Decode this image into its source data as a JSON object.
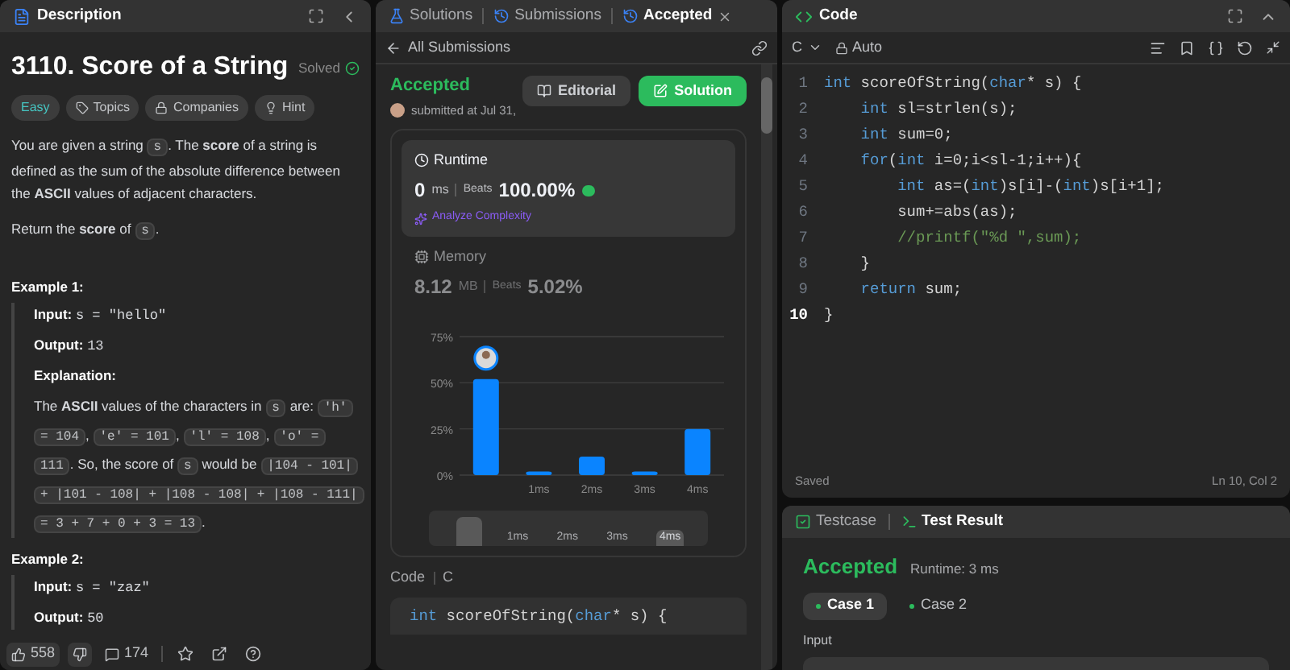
{
  "description_panel": {
    "tab": "Description",
    "title": "3110. Score of a String",
    "status": "Solved",
    "tags": [
      {
        "kind": "difficulty",
        "label": "Easy"
      },
      {
        "kind": "topics",
        "label": "Topics"
      },
      {
        "kind": "companies",
        "label": "Companies"
      },
      {
        "kind": "hint",
        "label": "Hint"
      }
    ],
    "paragraphs": [
      [
        {
          "kind": "text",
          "text": "You are given a string "
        },
        {
          "kind": "code",
          "text": "s"
        },
        {
          "kind": "text",
          "text": ". The **score** of a string is defined as the sum of the absolute difference between the **ASCII** values of adjacent characters."
        }
      ],
      [
        {
          "kind": "text",
          "text": "Return the **score** of "
        },
        {
          "kind": "code",
          "text": "s"
        },
        {
          "kind": "text",
          "text": "."
        }
      ]
    ],
    "examples": [
      {
        "title": "Example 1:",
        "input_label": "Input:",
        "input": "s = \"hello\"",
        "output_label": "Output:",
        "output": "13",
        "explanation_label": "Explanation:",
        "explanation": [
          {
            "kind": "text",
            "text": "The **ASCII** values of the characters in "
          },
          {
            "kind": "code",
            "text": "s"
          },
          {
            "kind": "text",
            "text": " are: "
          },
          {
            "kind": "code",
            "text": "'h' = 104"
          },
          {
            "kind": "text",
            "text": ", "
          },
          {
            "kind": "code",
            "text": "'e' = 101"
          },
          {
            "kind": "text",
            "text": ", "
          },
          {
            "kind": "code",
            "text": "'l' = 108"
          },
          {
            "kind": "text",
            "text": ", "
          },
          {
            "kind": "code",
            "text": "'o' = 111"
          },
          {
            "kind": "text",
            "text": ". So, the score of "
          },
          {
            "kind": "code",
            "text": "s"
          },
          {
            "kind": "text",
            "text": " would be "
          },
          {
            "kind": "code",
            "text": "|104 - 101| + |101 - 108| + |108 - 108| + |108 - 111| = 3 + 7 + 0 + 3 = 13"
          },
          {
            "kind": "text",
            "text": "."
          }
        ]
      },
      {
        "title": "Example 2:",
        "input_label": "Input:",
        "input": "s = \"zaz\"",
        "output_label": "Output:",
        "output": "50"
      }
    ],
    "footer": {
      "likes": "558",
      "comments": "174"
    }
  },
  "submission_panel": {
    "tabs": [
      {
        "kind": "solutions",
        "label": "Solutions",
        "selected": false
      },
      {
        "kind": "submissions",
        "label": "Submissions",
        "selected": false
      },
      {
        "kind": "submission",
        "label": "Accepted",
        "selected": true
      }
    ],
    "back_link": "All Submissions",
    "status": "Accepted",
    "submitted": "submitted at Jul 31,",
    "buttons": [
      {
        "kind": "editorial",
        "label": "Editorial"
      },
      {
        "kind": "solution",
        "label": "Solution"
      }
    ],
    "stats": [
      {
        "kind": "runtime",
        "label": "Runtime",
        "value": "0",
        "unit": "ms",
        "beats_label": "Beats",
        "beats": "100.00%",
        "link": "Analyze Complexity",
        "selected": true
      },
      {
        "kind": "memory",
        "label": "Memory",
        "value": "8.12",
        "unit": "MB",
        "beats_label": "Beats",
        "beats": "5.02%",
        "selected": false
      }
    ],
    "chart_data": {
      "type": "bar",
      "x": [
        0,
        1,
        2,
        3,
        4
      ],
      "xlim": [
        -0.5,
        4.5
      ],
      "values": [
        52,
        2,
        10,
        2,
        25
      ],
      "xticks": [
        {
          "value": 1,
          "label": "1ms"
        },
        {
          "value": 2,
          "label": "2ms"
        },
        {
          "value": 3,
          "label": "3ms"
        },
        {
          "value": 4,
          "label": "4ms"
        }
      ],
      "ylim": [
        0,
        75
      ],
      "grid": true,
      "yticks": [
        {
          "value": 0,
          "label": "0%"
        },
        {
          "value": 25,
          "label": "25%"
        },
        {
          "value": 50,
          "label": "50%"
        },
        {
          "value": 75,
          "label": "75%"
        }
      ]
    },
    "range_labels": [
      "1ms",
      "2ms",
      "3ms",
      "4ms"
    ],
    "code_label": "Code",
    "language": "C",
    "code_preview": [
      {
        "kind": "kw",
        "text": "int"
      },
      {
        "kind": "plain",
        "text": " scoreOfString("
      },
      {
        "kind": "kw",
        "text": "char"
      },
      {
        "kind": "plain",
        "text": "* s) {"
      }
    ]
  },
  "code_panel": {
    "title": "Code",
    "language": "C",
    "mode": "Auto",
    "lines": [
      {
        "number": "1",
        "current": false,
        "tokens": [
          {
            "kind": "kw",
            "text": "int"
          },
          {
            "kind": "plain",
            "text": " scoreOfString("
          },
          {
            "kind": "kw",
            "text": "char"
          },
          {
            "kind": "plain",
            "text": "* s) {"
          }
        ]
      },
      {
        "number": "2",
        "current": false,
        "tokens": [
          {
            "kind": "kw",
            "text": "    int"
          },
          {
            "kind": "plain",
            "text": " sl=strlen(s);"
          }
        ]
      },
      {
        "number": "3",
        "current": false,
        "tokens": [
          {
            "kind": "kw",
            "text": "    int"
          },
          {
            "kind": "plain",
            "text": " sum=0;"
          }
        ]
      },
      {
        "number": "4",
        "current": false,
        "tokens": [
          {
            "kind": "kw",
            "text": "    for"
          },
          {
            "kind": "plain",
            "text": "("
          },
          {
            "kind": "kw",
            "text": "int"
          },
          {
            "kind": "plain",
            "text": " i=0;i<sl-1;i++){"
          }
        ]
      },
      {
        "number": "5",
        "current": false,
        "tokens": [
          {
            "kind": "kw",
            "text": "        int"
          },
          {
            "kind": "plain",
            "text": " as=("
          },
          {
            "kind": "kw",
            "text": "int"
          },
          {
            "kind": "plain",
            "text": ")s[i]-("
          },
          {
            "kind": "kw",
            "text": "int"
          },
          {
            "kind": "plain",
            "text": ")s[i+1];"
          }
        ]
      },
      {
        "number": "6",
        "current": false,
        "tokens": [
          {
            "kind": "plain",
            "text": "        sum+=abs(as);"
          }
        ]
      },
      {
        "number": "7",
        "current": false,
        "tokens": [
          {
            "kind": "comment",
            "text": "        //printf(\"%d \",sum);"
          }
        ]
      },
      {
        "number": "8",
        "current": false,
        "tokens": [
          {
            "kind": "plain",
            "text": "    }"
          }
        ]
      },
      {
        "number": "9",
        "current": false,
        "tokens": [
          {
            "kind": "kw",
            "text": "    return"
          },
          {
            "kind": "plain",
            "text": " sum;"
          }
        ]
      },
      {
        "number": "10",
        "current": true,
        "tokens": [
          {
            "kind": "plain",
            "text": "}"
          }
        ]
      }
    ],
    "status": "Saved",
    "cursor": "Ln 10, Col 2"
  },
  "result_panel": {
    "tabs": [
      {
        "kind": "testcase",
        "label": "Testcase",
        "selected": false
      },
      {
        "kind": "result",
        "label": "Test Result",
        "selected": true
      }
    ],
    "status": "Accepted",
    "runtime": "Runtime: 3 ms",
    "cases": [
      {
        "label": "Case 1",
        "selected": true
      },
      {
        "label": "Case 2",
        "selected": false
      }
    ],
    "input_label": "Input"
  }
}
